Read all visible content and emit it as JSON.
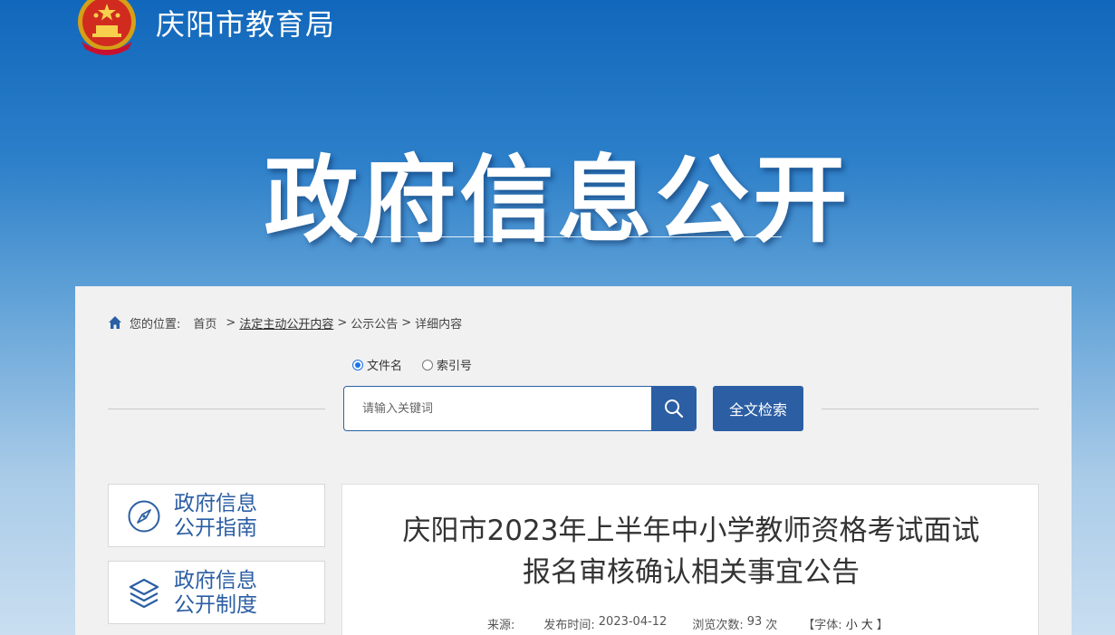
{
  "header": {
    "site_name": "庆阳市教育局"
  },
  "hero": {
    "title": "政府信息公开"
  },
  "breadcrumb": {
    "prefix": "您的位置:",
    "home": "首页",
    "sep": ">",
    "section": "法定主动公开内容",
    "category": "公示公告",
    "current": "详细内容"
  },
  "search": {
    "options": [
      {
        "label": "文件名",
        "selected": true
      },
      {
        "label": "索引号",
        "selected": false
      }
    ],
    "placeholder": "请输入关键词",
    "fulltext_label": "全文检索"
  },
  "sidebar": [
    {
      "line1": "政府信息",
      "line2": "公开指南",
      "icon": "compass-icon"
    },
    {
      "line1": "政府信息",
      "line2": "公开制度",
      "icon": "layers-icon"
    }
  ],
  "article": {
    "title_line1": "庆阳市2023年上半年中小学教师资格考试面试",
    "title_line2": "报名审核确认相关事宜公告",
    "meta": {
      "source_label": "来源:",
      "source_value": "",
      "date_label": "发布时间:",
      "date_value": "2023-04-12",
      "views_label": "浏览次数:",
      "views_value": "93",
      "views_unit": "次",
      "font_open": "【字体:",
      "font_small": "小",
      "font_large": "大",
      "font_close": "】"
    }
  },
  "colors": {
    "primary_blue": "#2b5ea3",
    "header_blue": "#1167bb",
    "panel_bg": "#f1f1f1"
  }
}
